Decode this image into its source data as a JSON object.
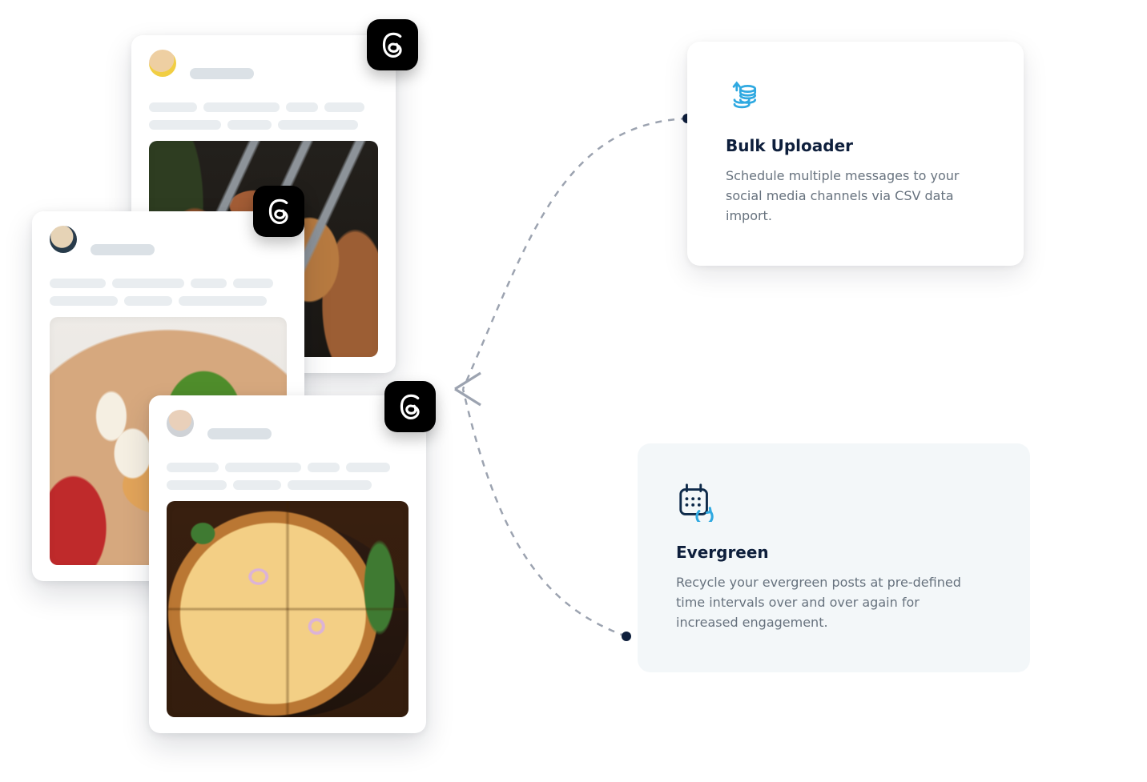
{
  "features": {
    "bulk": {
      "title": "Bulk Uploader",
      "description": "Schedule multiple messages to your social media channels via CSV data import."
    },
    "evergreen": {
      "title": "Evergreen",
      "description": "Recycle your evergreen posts at pre-defined time intervals over and over again for increased engagement."
    }
  },
  "posts": [
    {
      "photo": "kebabs-grill",
      "icon": "threads-icon"
    },
    {
      "photo": "salad-bowl",
      "icon": "threads-icon"
    },
    {
      "photo": "pizza-board",
      "icon": "threads-icon"
    }
  ],
  "colors": {
    "accent": "#2fa9e1",
    "ink": "#0e1f3c",
    "muted": "#67727e",
    "evergreen_bg": "#f3f7f9"
  }
}
